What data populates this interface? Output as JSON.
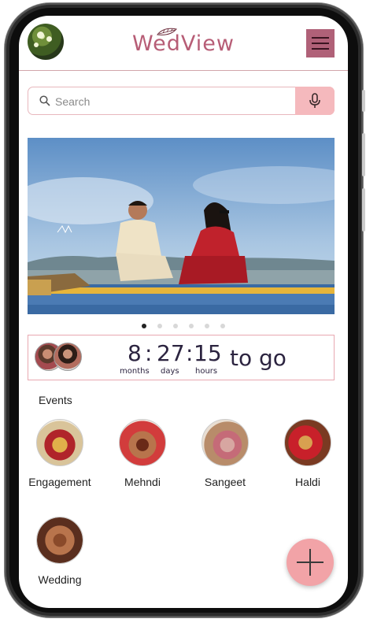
{
  "header": {
    "app_title": "WedView",
    "menu_icon": "hamburger-menu-icon",
    "avatar_icon": "profile-avatar"
  },
  "search": {
    "placeholder": "Search",
    "search_icon": "search-icon",
    "mic_icon": "microphone-icon"
  },
  "carousel": {
    "slide_count": 6,
    "active_index": 0
  },
  "countdown": {
    "months_value": "8",
    "days_value": "27",
    "hours_value": "15",
    "months_label": "months",
    "days_label": "days",
    "hours_label": "hours",
    "separator": ":",
    "suffix": "to go"
  },
  "events": {
    "title": "Events",
    "items": [
      {
        "label": "Engagement"
      },
      {
        "label": "Mehndi"
      },
      {
        "label": "Sangeet"
      },
      {
        "label": "Haldi"
      },
      {
        "label": "Wedding"
      }
    ]
  },
  "fab": {
    "icon": "plus-icon"
  },
  "colors": {
    "brand": "#b75d76",
    "menu_button": "#b06178",
    "mic_button": "#f5b9bd",
    "fab": "#f2a3a7",
    "border": "#e8a8b1"
  }
}
